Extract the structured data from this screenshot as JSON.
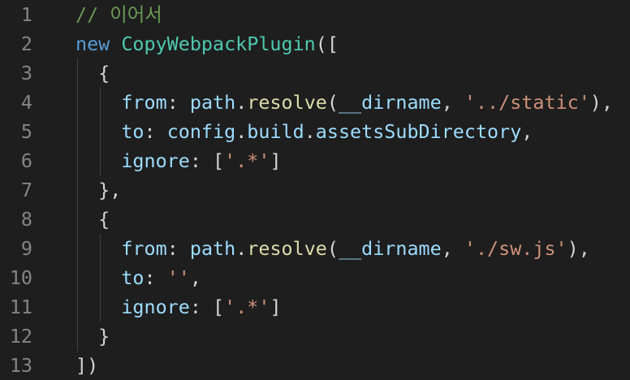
{
  "editor": {
    "lines": [
      {
        "number": "1",
        "tokens": [
          {
            "text": "// 이어서",
            "kind": "comment"
          }
        ]
      },
      {
        "number": "2",
        "tokens": [
          {
            "text": "new",
            "kind": "kw"
          },
          {
            "text": " ",
            "kind": "punc"
          },
          {
            "text": "CopyWebpackPlugin",
            "kind": "class"
          },
          {
            "text": "([",
            "kind": "punc"
          }
        ]
      },
      {
        "number": "3",
        "tokens": [
          {
            "text": "  {",
            "kind": "punc"
          }
        ]
      },
      {
        "number": "4",
        "tokens": [
          {
            "text": "    ",
            "kind": "punc"
          },
          {
            "text": "from",
            "kind": "prop"
          },
          {
            "text": ": ",
            "kind": "punc"
          },
          {
            "text": "path",
            "kind": "prop"
          },
          {
            "text": ".",
            "kind": "punc"
          },
          {
            "text": "resolve",
            "kind": "func"
          },
          {
            "text": "(",
            "kind": "punc"
          },
          {
            "text": "__dirname",
            "kind": "prop"
          },
          {
            "text": ", ",
            "kind": "punc"
          },
          {
            "text": "'../static'",
            "kind": "str"
          },
          {
            "text": "),",
            "kind": "punc"
          }
        ]
      },
      {
        "number": "5",
        "tokens": [
          {
            "text": "    ",
            "kind": "punc"
          },
          {
            "text": "to",
            "kind": "prop"
          },
          {
            "text": ": ",
            "kind": "punc"
          },
          {
            "text": "config",
            "kind": "prop"
          },
          {
            "text": ".",
            "kind": "punc"
          },
          {
            "text": "build",
            "kind": "prop"
          },
          {
            "text": ".",
            "kind": "punc"
          },
          {
            "text": "assetsSubDirectory",
            "kind": "prop"
          },
          {
            "text": ",",
            "kind": "punc"
          }
        ]
      },
      {
        "number": "6",
        "tokens": [
          {
            "text": "    ",
            "kind": "punc"
          },
          {
            "text": "ignore",
            "kind": "prop"
          },
          {
            "text": ": [",
            "kind": "punc"
          },
          {
            "text": "'.*'",
            "kind": "str"
          },
          {
            "text": "]",
            "kind": "punc"
          }
        ]
      },
      {
        "number": "7",
        "tokens": [
          {
            "text": "  },",
            "kind": "punc"
          }
        ]
      },
      {
        "number": "8",
        "tokens": [
          {
            "text": "  {",
            "kind": "punc"
          }
        ]
      },
      {
        "number": "9",
        "tokens": [
          {
            "text": "    ",
            "kind": "punc"
          },
          {
            "text": "from",
            "kind": "prop"
          },
          {
            "text": ": ",
            "kind": "punc"
          },
          {
            "text": "path",
            "kind": "prop"
          },
          {
            "text": ".",
            "kind": "punc"
          },
          {
            "text": "resolve",
            "kind": "func"
          },
          {
            "text": "(",
            "kind": "punc"
          },
          {
            "text": "__dirname",
            "kind": "prop"
          },
          {
            "text": ", ",
            "kind": "punc"
          },
          {
            "text": "'./sw.js'",
            "kind": "str"
          },
          {
            "text": "),",
            "kind": "punc"
          }
        ]
      },
      {
        "number": "10",
        "tokens": [
          {
            "text": "    ",
            "kind": "punc"
          },
          {
            "text": "to",
            "kind": "prop"
          },
          {
            "text": ": ",
            "kind": "punc"
          },
          {
            "text": "''",
            "kind": "str"
          },
          {
            "text": ",",
            "kind": "punc"
          }
        ]
      },
      {
        "number": "11",
        "tokens": [
          {
            "text": "    ",
            "kind": "punc"
          },
          {
            "text": "ignore",
            "kind": "prop"
          },
          {
            "text": ": [",
            "kind": "punc"
          },
          {
            "text": "'.*'",
            "kind": "str"
          },
          {
            "text": "]",
            "kind": "punc"
          }
        ]
      },
      {
        "number": "12",
        "tokens": [
          {
            "text": "  }",
            "kind": "punc"
          }
        ]
      },
      {
        "number": "13",
        "tokens": [
          {
            "text": "])",
            "kind": "punc"
          }
        ]
      }
    ]
  },
  "theme": {
    "background": "#1e1e1e",
    "line_number": "#858585",
    "comment": "#6a9955",
    "keyword": "#569cd6",
    "class_name": "#4ec9b0",
    "property": "#9cdcfe",
    "function": "#dcdcaa",
    "string": "#ce9178",
    "punctuation": "#d4d4d4",
    "indent_guide": "#404040"
  }
}
